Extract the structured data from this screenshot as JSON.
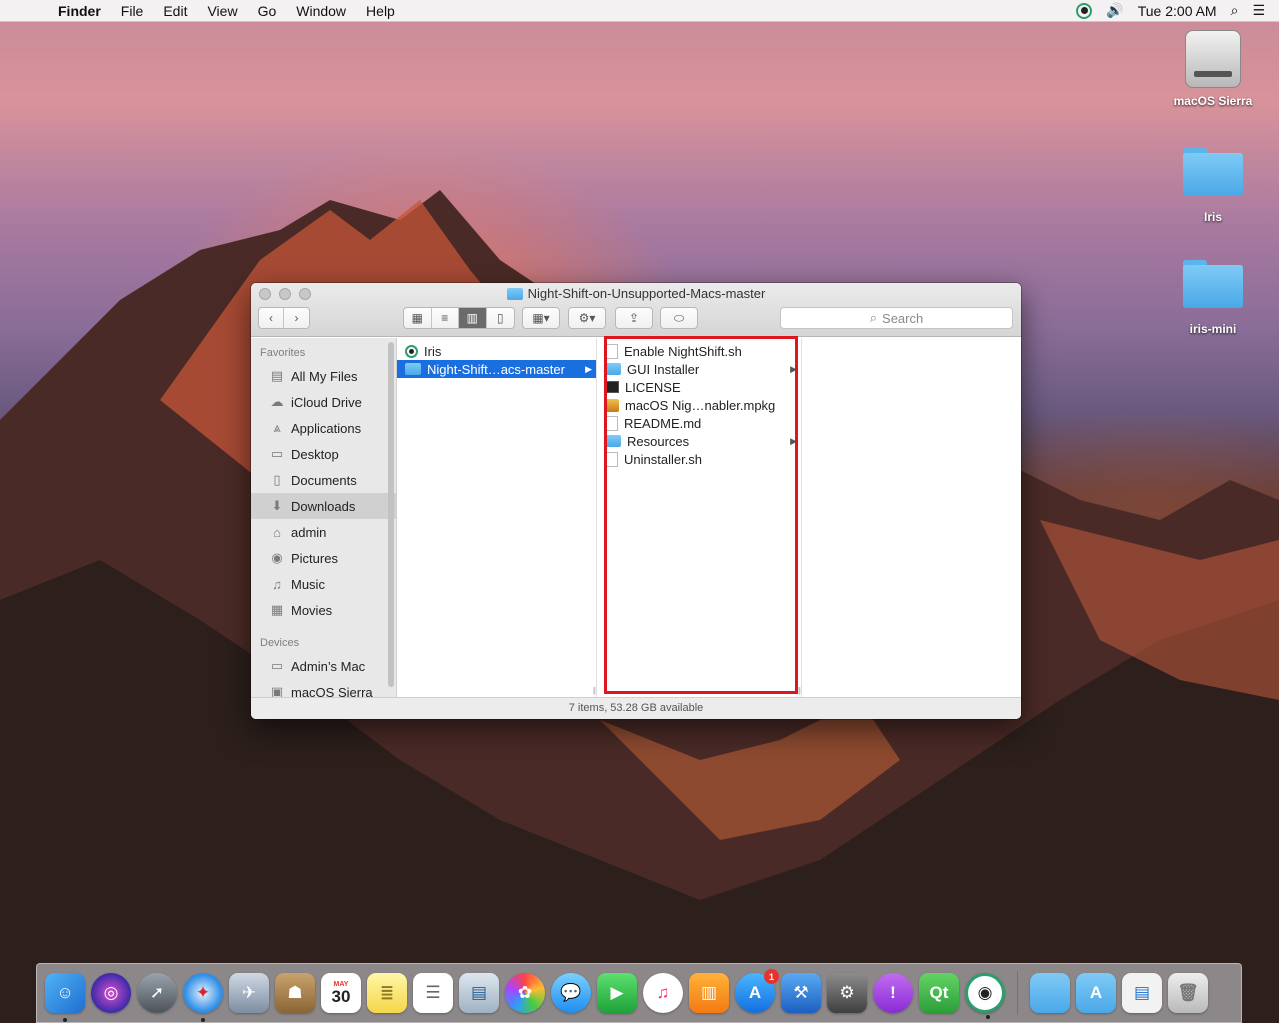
{
  "menubar": {
    "app_name": "Finder",
    "menus": [
      "File",
      "Edit",
      "View",
      "Go",
      "Window",
      "Help"
    ],
    "clock": "Tue 2:00 AM"
  },
  "desktop": {
    "icons": [
      {
        "label": "macOS Sierra",
        "kind": "disk-icon"
      },
      {
        "label": "Iris",
        "kind": "folder-icon"
      },
      {
        "label": "iris-mini",
        "kind": "folder-icon"
      }
    ]
  },
  "window": {
    "title": "Night-Shift-on-Unsupported-Macs-master",
    "search_placeholder": "Search",
    "status": "7 items, 53.28 GB available",
    "sidebar": {
      "favorites_header": "Favorites",
      "favorites": [
        {
          "label": "All My Files",
          "icon": "all-files-icon"
        },
        {
          "label": "iCloud Drive",
          "icon": "cloud-icon"
        },
        {
          "label": "Applications",
          "icon": "applications-icon"
        },
        {
          "label": "Desktop",
          "icon": "desktop-icon"
        },
        {
          "label": "Documents",
          "icon": "documents-icon"
        },
        {
          "label": "Downloads",
          "icon": "downloads-icon",
          "selected": true
        },
        {
          "label": "admin",
          "icon": "home-icon"
        },
        {
          "label": "Pictures",
          "icon": "camera-icon"
        },
        {
          "label": "Music",
          "icon": "music-note-icon"
        },
        {
          "label": "Movies",
          "icon": "film-icon"
        }
      ],
      "devices_header": "Devices",
      "devices": [
        {
          "label": "Admin’s Mac",
          "icon": "computer-icon"
        },
        {
          "label": "macOS Sierra",
          "icon": "disk-icon"
        }
      ]
    },
    "column1": [
      {
        "label": "Iris",
        "icon": "iris-app-icon"
      },
      {
        "label": "Night-Shift…acs-master",
        "icon": "folder-icon",
        "selected": true
      }
    ],
    "column2": [
      {
        "label": "Enable NightShift.sh",
        "icon": "file-icon"
      },
      {
        "label": "GUI Installer",
        "icon": "folder-icon"
      },
      {
        "label": "LICENSE",
        "icon": "terminal-icon"
      },
      {
        "label": "macOS Nig…nabler.mpkg",
        "icon": "package-icon"
      },
      {
        "label": "README.md",
        "icon": "file-icon"
      },
      {
        "label": "Resources",
        "icon": "folder-icon"
      },
      {
        "label": "Uninstaller.sh",
        "icon": "file-icon"
      }
    ]
  },
  "dock": {
    "calendar_month": "MAY",
    "calendar_day": "30",
    "appstore_badge": "1",
    "qt_label": "Qt"
  },
  "colors": {
    "selection": "#1a6fe0",
    "highlight_box": "#e0161e"
  }
}
